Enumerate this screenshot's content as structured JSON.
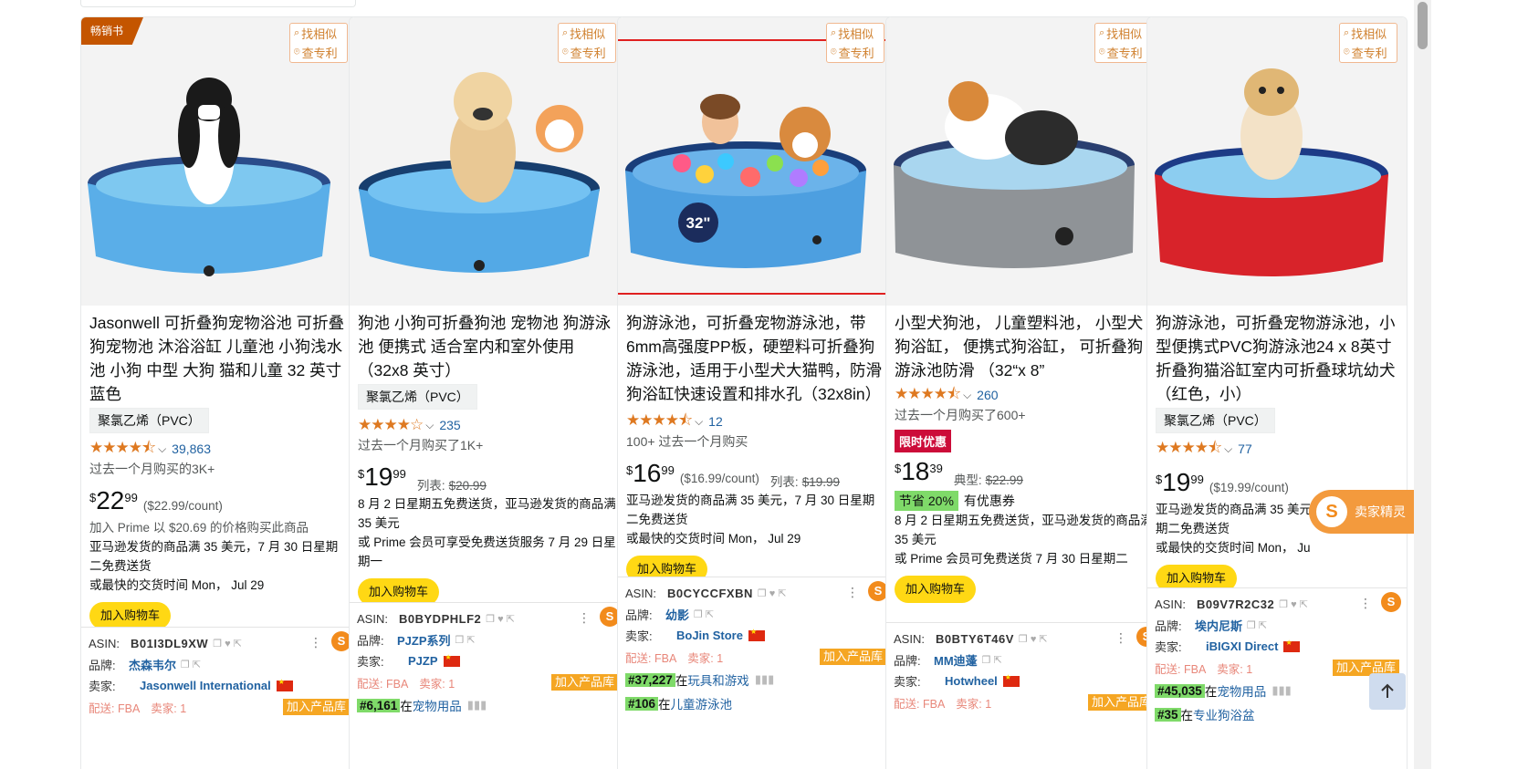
{
  "widgets": {
    "find_similar": "找相似",
    "check_patent": "查专利",
    "bestseller": "畅销书",
    "add_to_cart": "加入购物车",
    "seller_helper": "卖家精灵",
    "add_to_library": "加入产品库"
  },
  "plugin_labels": {
    "asin": "ASIN:",
    "brand": "品牌:",
    "seller": "卖家:",
    "delivery": "配送:",
    "fba": "FBA",
    "sellers_count_prefix": "卖家: ",
    "rank_prefix": "在"
  },
  "products": [
    {
      "title": "Jasonwell 可折叠狗宠物浴池 可折叠狗宠物池 沐浴浴缸 儿童池 小狗浅水池 小狗 中型 大狗 猫和儿童 32 英寸 蓝色",
      "material": "聚氯乙烯（PVC）",
      "stars": "★★★★⯪",
      "reviews": "39,863",
      "bought": "过去一个月购买的3K+",
      "price_whole": "22",
      "price_frac": "99",
      "price_unit": "($22.99/count)",
      "lines": [
        "加入 Prime 以 $20.69 的价格购买此商品",
        "亚马逊发货的商品满 35 美元，7 月 30 日星期二免费送货",
        "或最快的交货时间 Mon， Jul 29"
      ],
      "asin": "B01I3DL9XW",
      "brand": "杰森韦尔",
      "seller": "Jasonwell International",
      "seller_count": "1",
      "rank1_num": "",
      "rank1_cat": ""
    },
    {
      "title": "狗池 小狗可折叠狗池 宠物池 狗游泳池 便携式 适合室内和室外使用 （32x8 英寸）",
      "material": "聚氯乙烯（PVC）",
      "stars": "★★★★☆",
      "reviews": "235",
      "bought": "过去一个月购买了1K+",
      "price_whole": "19",
      "price_frac": "99",
      "list_label": "列表:",
      "list_price": "$20.99",
      "lines": [
        "8 月 2 日星期五免费送货，亚马逊发货的商品满 35 美元",
        "或 Prime 会员可享受免费送货服务 7 月 29 日星期一"
      ],
      "asin": "B0BYDPHLF2",
      "brand": "PJZP系列",
      "seller": "PJZP",
      "seller_count": "1",
      "rank1_num": "#6,161",
      "rank1_cat": "宠物用品"
    },
    {
      "title": "狗游泳池，可折叠宠物游泳池，带 6mm高强度PP板，硬塑料可折叠狗游泳池，适用于小型犬大猫鸭，防滑狗浴缸快速设置和排水孔（32x8in）",
      "stars": "★★★★⯪",
      "reviews": "12",
      "bought": "100+ 过去一个月购买",
      "price_whole": "16",
      "price_frac": "99",
      "price_unit": "($16.99/count)",
      "list_label": "列表:",
      "list_price": "$19.99",
      "lines": [
        "亚马逊发货的商品满 35 美元，7 月 30 日星期二免费送货",
        "或最快的交货时间 Mon， Jul 29"
      ],
      "asin": "B0CYCCFXBN",
      "brand": "幼影",
      "seller": "BoJin Store",
      "seller_count": "1",
      "rank1_num": "#37,227",
      "rank1_cat": "玩具和游戏",
      "rank2_num": "#106",
      "rank2_cat": "儿童游泳池"
    },
    {
      "title": "小型犬狗池， 儿童塑料池， 小型犬狗浴缸， 便携式狗浴缸， 可折叠狗游泳池防滑 （32“x 8”",
      "stars": "★★★★⯪",
      "reviews": "260",
      "bought": "过去一个月购买了600+",
      "deal": "限时优惠",
      "price_whole": "18",
      "price_frac": "39",
      "list_label": "典型:",
      "list_price": "$22.99",
      "save": "节省 20%",
      "save_note": "有优惠券",
      "lines": [
        "8 月 2 日星期五免费送货，亚马逊发货的商品满 35 美元",
        "或 Prime 会员可免费送货 7 月 30 日星期二"
      ],
      "asin": "B0BTY6T46V",
      "brand": "MM迪蓬",
      "seller": "Hotwheel",
      "seller_count": "1",
      "rank1_num": "",
      "rank1_cat": ""
    },
    {
      "title": "狗游泳池，可折叠宠物游泳池，小型便携式PVC狗游泳池24 x 8英寸折叠狗猫浴缸室内可折叠球坑幼犬（红色，小）",
      "material": "聚氯乙烯（PVC）",
      "stars": "★★★★⯪",
      "reviews": "77",
      "price_whole": "19",
      "price_frac": "99",
      "price_unit": "($19.99/count)",
      "lines": [
        "亚马逊发货的商品满 35 美元，7 月 30 日星期二免费送货",
        "或最快的交货时间 Mon， Ju"
      ],
      "asin": "B09V7R2C32",
      "brand": "埃内尼斯",
      "seller": "iBIGXI Direct",
      "seller_count": "1",
      "rank1_num": "#45,035",
      "rank1_cat": "宠物用品",
      "rank2_num": "#35",
      "rank2_cat": "专业狗浴盆"
    }
  ]
}
